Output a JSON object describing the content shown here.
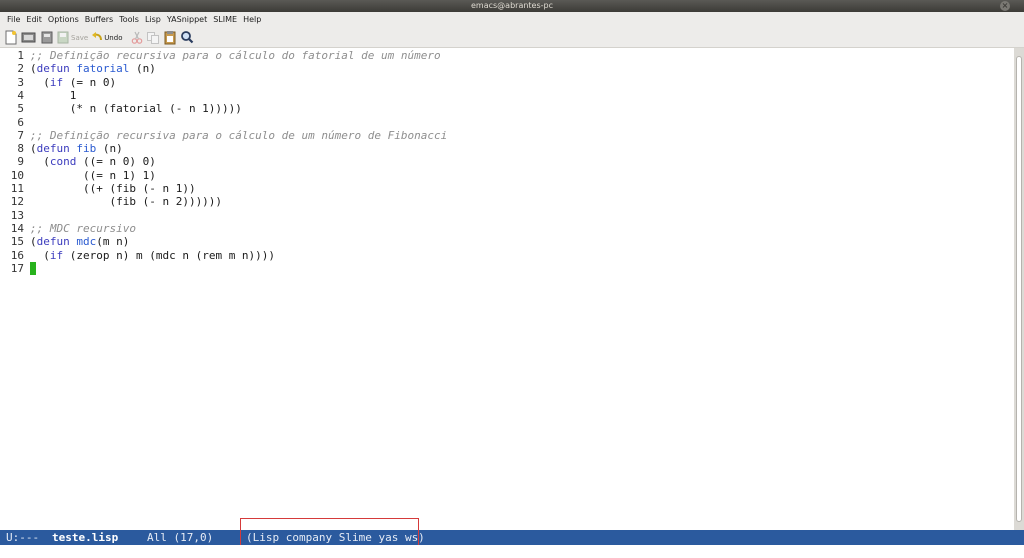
{
  "window": {
    "title": "emacs@abrantes-pc",
    "close_glyph": "×"
  },
  "menubar": {
    "items": [
      "File",
      "Edit",
      "Options",
      "Buffers",
      "Tools",
      "Lisp",
      "YASnippet",
      "SLIME",
      "Help"
    ]
  },
  "toolbar": {
    "save_label": "Save",
    "undo_label": "Undo",
    "icons": [
      "new-file-icon",
      "open-folder-icon",
      "close-icon",
      "save-icon",
      "undo-icon",
      "cut-icon",
      "copy-icon",
      "paste-icon",
      "search-icon"
    ]
  },
  "editor": {
    "lines": [
      {
        "num": "1",
        "parts": [
          {
            "t": ";; Definição recursiva para o cálculo do fatorial de um número",
            "c": "c-comment"
          }
        ]
      },
      {
        "num": "2",
        "parts": [
          {
            "t": "(",
            "c": ""
          },
          {
            "t": "defun",
            "c": "c-kw"
          },
          {
            "t": " ",
            "c": ""
          },
          {
            "t": "fatorial",
            "c": "c-fn"
          },
          {
            "t": " (n)",
            "c": ""
          }
        ]
      },
      {
        "num": "3",
        "parts": [
          {
            "t": "  (",
            "c": ""
          },
          {
            "t": "if",
            "c": "c-kw"
          },
          {
            "t": " (= n 0)",
            "c": ""
          }
        ]
      },
      {
        "num": "4",
        "parts": [
          {
            "t": "      1",
            "c": ""
          }
        ]
      },
      {
        "num": "5",
        "parts": [
          {
            "t": "      (* n (fatorial (- n 1)))))",
            "c": ""
          }
        ]
      },
      {
        "num": "6",
        "parts": []
      },
      {
        "num": "7",
        "parts": [
          {
            "t": ";; Definição recursiva para o cálculo de um número de Fibonacci",
            "c": "c-comment"
          }
        ]
      },
      {
        "num": "8",
        "parts": [
          {
            "t": "(",
            "c": ""
          },
          {
            "t": "defun",
            "c": "c-kw"
          },
          {
            "t": " ",
            "c": ""
          },
          {
            "t": "fib",
            "c": "c-fn"
          },
          {
            "t": " (n)",
            "c": ""
          }
        ]
      },
      {
        "num": "9",
        "parts": [
          {
            "t": "  (",
            "c": ""
          },
          {
            "t": "cond",
            "c": "c-kw"
          },
          {
            "t": " ((= n 0) 0)",
            "c": ""
          }
        ]
      },
      {
        "num": "10",
        "parts": [
          {
            "t": "        ((= n 1) 1)",
            "c": ""
          }
        ]
      },
      {
        "num": "11",
        "parts": [
          {
            "t": "        ((+ (fib (- n 1))",
            "c": ""
          }
        ]
      },
      {
        "num": "12",
        "parts": [
          {
            "t": "            (fib (- n 2))))))",
            "c": ""
          }
        ]
      },
      {
        "num": "13",
        "parts": []
      },
      {
        "num": "14",
        "parts": [
          {
            "t": ";; MDC recursivo",
            "c": "c-comment"
          }
        ]
      },
      {
        "num": "15",
        "parts": [
          {
            "t": "(",
            "c": ""
          },
          {
            "t": "defun",
            "c": "c-kw"
          },
          {
            "t": " ",
            "c": ""
          },
          {
            "t": "mdc",
            "c": "c-fn"
          },
          {
            "t": "(m n)",
            "c": ""
          }
        ]
      },
      {
        "num": "16",
        "parts": [
          {
            "t": "  (",
            "c": ""
          },
          {
            "t": "if",
            "c": "c-kw"
          },
          {
            "t": " (zerop n) m (mdc n (rem m n))))",
            "c": ""
          }
        ]
      },
      {
        "num": "17",
        "parts": [],
        "cursor": true
      }
    ]
  },
  "modeline": {
    "status": "U:---",
    "buffer_name": "teste.lisp",
    "position": "All (17,0)",
    "modes": "(Lisp company Slime yas ws)"
  },
  "colors": {
    "modeline_bg": "#2b5a9e",
    "cursor": "#28b21c",
    "comment": "#8e8e8e",
    "keyword": "#3c3cbe",
    "function_name": "#2a5ad0",
    "highlight_box": "#d53a3a"
  }
}
